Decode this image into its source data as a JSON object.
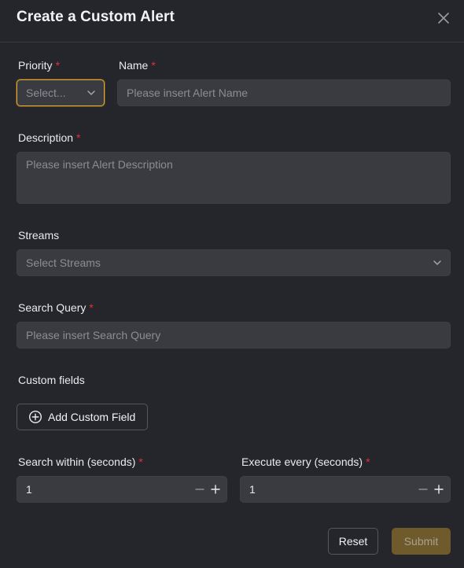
{
  "modal": {
    "title": "Create a Custom Alert",
    "close_icon": "close-icon"
  },
  "form": {
    "priority": {
      "label": "Priority",
      "required_mark": "*",
      "placeholder": "Select...",
      "icon": "chevron-down-icon"
    },
    "name": {
      "label": "Name",
      "required_mark": "*",
      "placeholder": "Please insert Alert Name"
    },
    "description": {
      "label": "Description",
      "required_mark": "*",
      "placeholder": "Please insert Alert Description"
    },
    "streams": {
      "label": "Streams",
      "placeholder": "Select Streams",
      "icon": "chevron-down-icon"
    },
    "search_query": {
      "label": "Search Query",
      "required_mark": "*",
      "placeholder": "Please insert Search Query"
    },
    "custom_fields": {
      "label": "Custom fields",
      "add_button_label": "Add Custom Field",
      "add_icon": "plus-circle-icon"
    },
    "search_within": {
      "label": "Search within (seconds)",
      "required_mark": "*",
      "value": "1"
    },
    "execute_every": {
      "label": "Execute every (seconds)",
      "required_mark": "*",
      "value": "1"
    }
  },
  "footer": {
    "reset_label": "Reset",
    "submit_label": "Submit"
  },
  "colors": {
    "background": "#25262b",
    "input_bg": "#3a3b40",
    "required": "#e03131",
    "focus_border": "#d9a63a",
    "submit_bg": "#6f5a2b"
  }
}
